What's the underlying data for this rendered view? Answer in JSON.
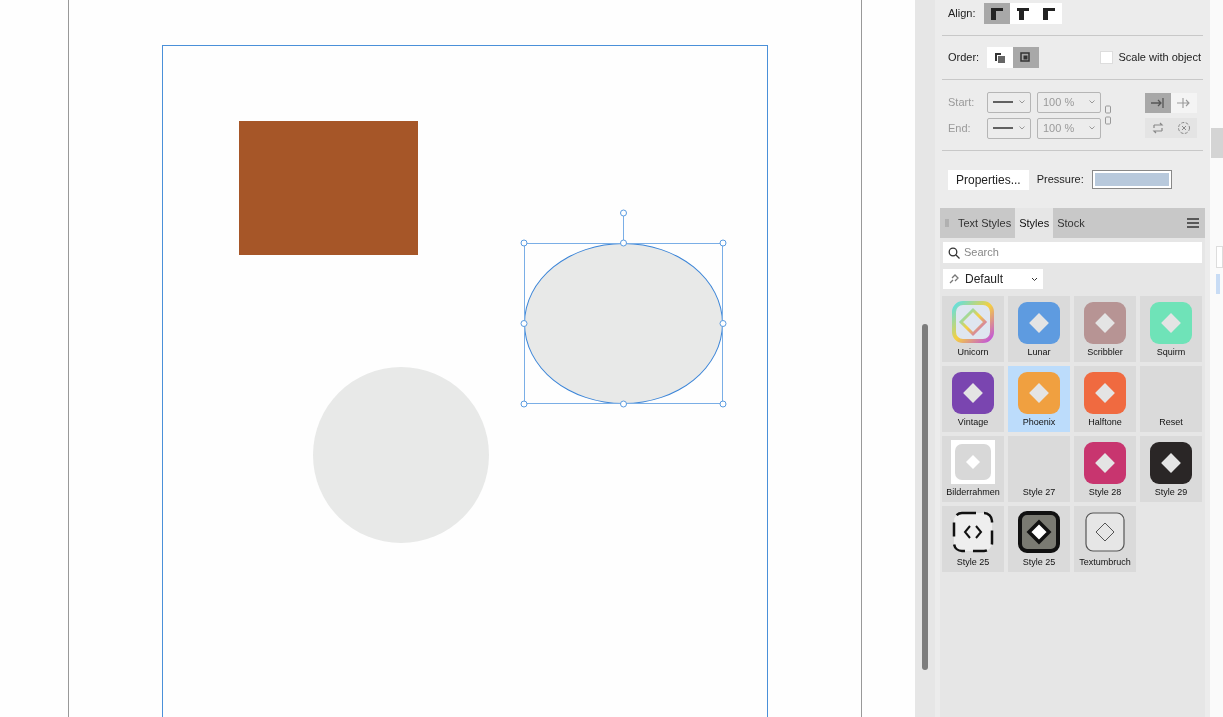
{
  "canvas": {
    "shapes": [
      {
        "kind": "rectangle",
        "color": "#a65628",
        "selected": false
      },
      {
        "kind": "ellipse",
        "color": "#e8e9e8",
        "selected": true
      },
      {
        "kind": "circle",
        "color": "#e8e9e8",
        "selected": false
      }
    ]
  },
  "align": {
    "label": "Align:",
    "buttons": [
      {
        "selected": true
      },
      {
        "selected": false
      },
      {
        "selected": false
      }
    ]
  },
  "order": {
    "label": "Order:",
    "buttons": [
      {
        "selected": false
      },
      {
        "selected": true
      }
    ]
  },
  "scale_with_object": {
    "label": "Scale with object",
    "checked": false
  },
  "arrowheads": {
    "disabled": true,
    "rows": [
      {
        "label": "Start:",
        "scale": "100 %"
      },
      {
        "label": "End:",
        "scale": "100 %"
      }
    ],
    "direction": [
      {
        "selected": true
      },
      {
        "selected": false
      }
    ]
  },
  "properties_button": "Properties...",
  "pressure": {
    "label": "Pressure:"
  },
  "styles_panel": {
    "tabs": [
      {
        "label": "Text Styles",
        "selected": false
      },
      {
        "label": "Styles",
        "selected": true
      },
      {
        "label": "Stock",
        "selected": false
      }
    ],
    "search": {
      "placeholder": "Search"
    },
    "category": "Default",
    "styles": [
      {
        "label": "Unicorn",
        "kind": "rainbow",
        "selected": false
      },
      {
        "label": "Lunar",
        "kind": "filled",
        "color": "#5e9be0",
        "selected": false
      },
      {
        "label": "Scribbler",
        "kind": "filled",
        "color": "#b79494",
        "selected": false
      },
      {
        "label": "Squirm",
        "kind": "filled",
        "color": "#6fe3b8",
        "selected": false
      },
      {
        "label": "Vintage",
        "kind": "filled",
        "color": "#7a45b0",
        "selected": false
      },
      {
        "label": "Phoenix",
        "kind": "filled",
        "color": "#f0a040",
        "selected": true
      },
      {
        "label": "Halftone",
        "kind": "filled",
        "color": "#f06a40",
        "selected": false
      },
      {
        "label": "Reset",
        "kind": "empty",
        "selected": false
      },
      {
        "label": "Bilderrahmen",
        "kind": "framed",
        "selected": false
      },
      {
        "label": "Style 27",
        "kind": "empty",
        "selected": false
      },
      {
        "label": "Style 28",
        "kind": "filled",
        "color": "#c8356f",
        "selected": false
      },
      {
        "label": "Style 29",
        "kind": "filled",
        "color": "#2a2626",
        "selected": false
      },
      {
        "label": "Style 25",
        "kind": "dashed",
        "selected": false
      },
      {
        "label": "Style 25",
        "kind": "bold-outline",
        "selected": false
      },
      {
        "label": "Textumbruch",
        "kind": "outline",
        "selected": false
      }
    ]
  }
}
